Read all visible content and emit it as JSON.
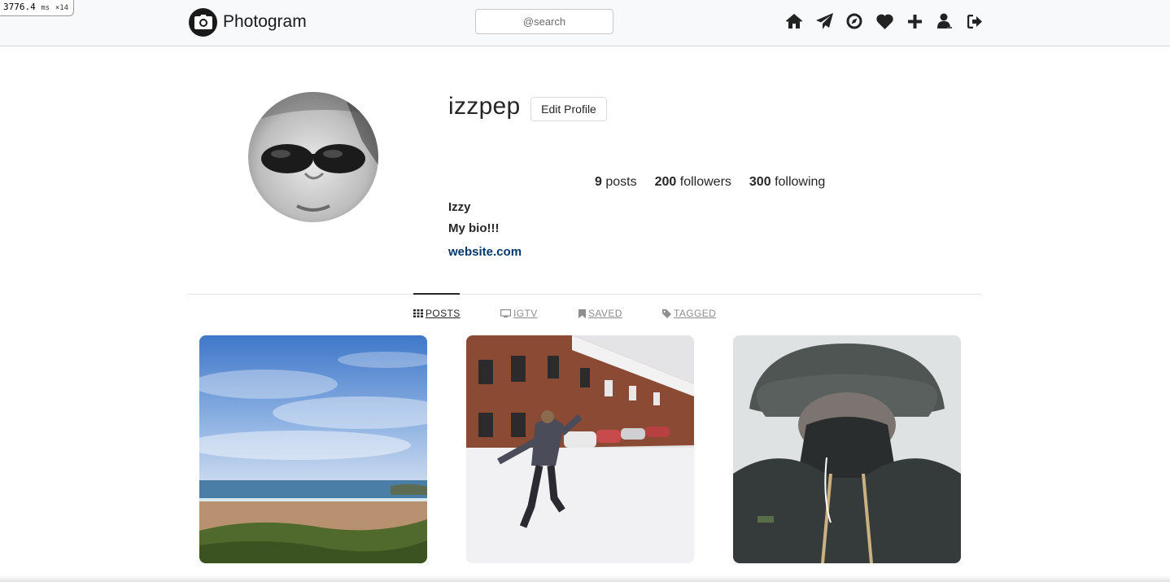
{
  "debug": {
    "value": "3776.4",
    "unit": "ms",
    "mult": "×14"
  },
  "brand": {
    "name": "Photogram"
  },
  "search": {
    "placeholder": "@search"
  },
  "nav": {
    "icons": [
      "home-icon",
      "paper-plane-icon",
      "compass-icon",
      "heart-icon",
      "plus-icon",
      "user-icon",
      "sign-out-icon"
    ]
  },
  "profile": {
    "username": "izzpep",
    "edit_label": "Edit Profile",
    "posts_count": "9",
    "posts_label": "posts",
    "followers_count": "200",
    "followers_label": "followers",
    "following_count": "300",
    "following_label": "following",
    "full_name": "Izzy",
    "bio": "My bio!!!",
    "website": "website.com"
  },
  "tabs": [
    {
      "label": "POSTS",
      "icon": "grid-icon",
      "active": true
    },
    {
      "label": "IGTV",
      "icon": "tv-icon",
      "active": false
    },
    {
      "label": "SAVED",
      "icon": "bookmark-icon",
      "active": false
    },
    {
      "label": "TAGGED",
      "icon": "tag-icon",
      "active": false
    }
  ],
  "posts": [
    {
      "subject": "beach-sky"
    },
    {
      "subject": "snowy-street"
    },
    {
      "subject": "hat-selfie"
    }
  ],
  "colors": {
    "accent_link": "#00376b",
    "header_bg": "#f8f9fa",
    "text": "#262626",
    "muted": "#8e8e8e"
  }
}
